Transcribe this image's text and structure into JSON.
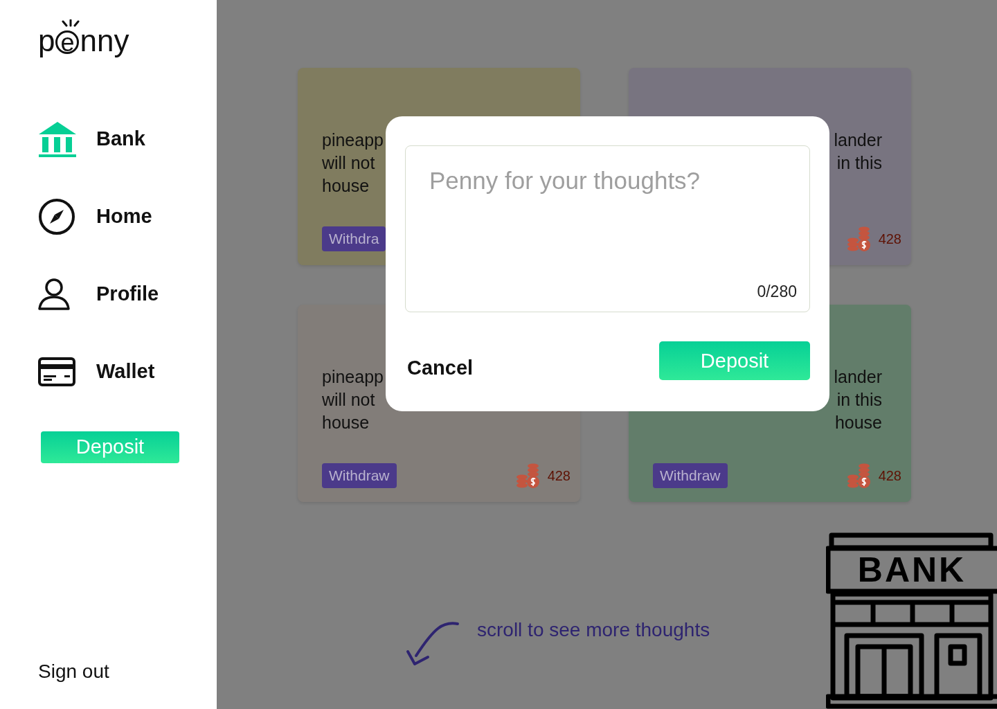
{
  "sidebar": {
    "logo": "penny",
    "nav": [
      {
        "label": "Bank",
        "selected": true
      },
      {
        "label": "Home",
        "selected": false
      },
      {
        "label": "Profile",
        "selected": false
      },
      {
        "label": "Wallet",
        "selected": false
      }
    ],
    "deposit_button": "Deposit",
    "sign_out": "Sign out"
  },
  "cards": [
    {
      "lines": [
        "pineapp",
        "will not",
        "house"
      ],
      "color": "#807c5f",
      "withdraw": "Withdra"
    },
    {
      "lines": [
        "lander",
        "in this"
      ],
      "color": "#787480",
      "coins": "428"
    },
    {
      "lines": [
        "pineapp",
        "will not",
        "house"
      ],
      "color": "#827d79",
      "withdraw": "Withdraw",
      "coins": "428"
    },
    {
      "lines": [
        "lander",
        "in this",
        "house"
      ],
      "color": "#627d6a",
      "withdraw": "Withdraw",
      "coins": "428"
    }
  ],
  "modal": {
    "placeholder": "Penny for your thoughts?",
    "counter": "0/280",
    "cancel": "Cancel",
    "deposit": "Deposit"
  },
  "scroll_hint": "scroll to see more thoughts",
  "bank_sign": "BANK"
}
